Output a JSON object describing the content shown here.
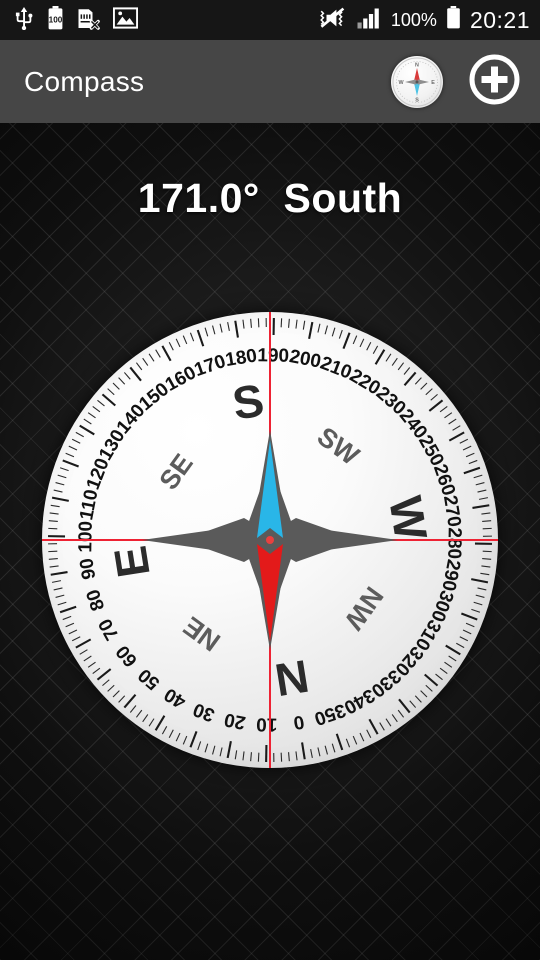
{
  "status_bar": {
    "background": "#161616",
    "left_icons": [
      {
        "name": "usb-icon",
        "label": "USB"
      },
      {
        "name": "battery-100-icon",
        "label": "100"
      },
      {
        "name": "sd-card-removed-icon",
        "label": "SD card removed"
      },
      {
        "name": "gallery-image-icon",
        "label": "Image"
      }
    ],
    "right_icons": [
      {
        "name": "mute-vibrate-icon",
        "label": "Sound off / vibrate"
      },
      {
        "name": "signal-bars-icon",
        "label": "Signal"
      }
    ],
    "battery_percent": "100%",
    "clock": "20:21"
  },
  "title_bar": {
    "background": "#464646",
    "title": "Compass",
    "compass_button_label": "Compass",
    "add_button_label": "Add"
  },
  "heading": {
    "degrees": "171.0°",
    "direction": "South",
    "full_text": "171.0°  South",
    "color": "#ffffff"
  },
  "compass": {
    "bearing_degrees": 171.0,
    "dial_rotation_css_deg": 171,
    "cardinals": [
      {
        "label": "N",
        "angle": 0
      },
      {
        "label": "E",
        "angle": 90
      },
      {
        "label": "S",
        "angle": 180
      },
      {
        "label": "W",
        "angle": 270
      }
    ],
    "intercardinals": [
      {
        "label": "NE",
        "angle": 45
      },
      {
        "label": "SE",
        "angle": 135
      },
      {
        "label": "SW",
        "angle": 225
      },
      {
        "label": "NW",
        "angle": 315
      }
    ],
    "degree_labels": [
      0,
      10,
      20,
      30,
      40,
      50,
      60,
      70,
      80,
      90,
      100,
      110,
      120,
      130,
      140,
      150,
      160,
      170,
      180,
      190,
      200,
      210,
      220,
      230,
      240,
      250,
      260,
      270,
      280,
      290,
      300,
      310,
      320,
      330,
      340,
      350
    ],
    "tick_step_minor_deg": 2,
    "tick_step_major_deg": 10,
    "needle_north_color": "#e31a1a",
    "needle_south_color": "#29b6e8",
    "rose_color": "#5a5a5a",
    "crosshair_color": "#ee2233",
    "dial_face_color": "#f4f4f4",
    "top_label_value": "170"
  }
}
